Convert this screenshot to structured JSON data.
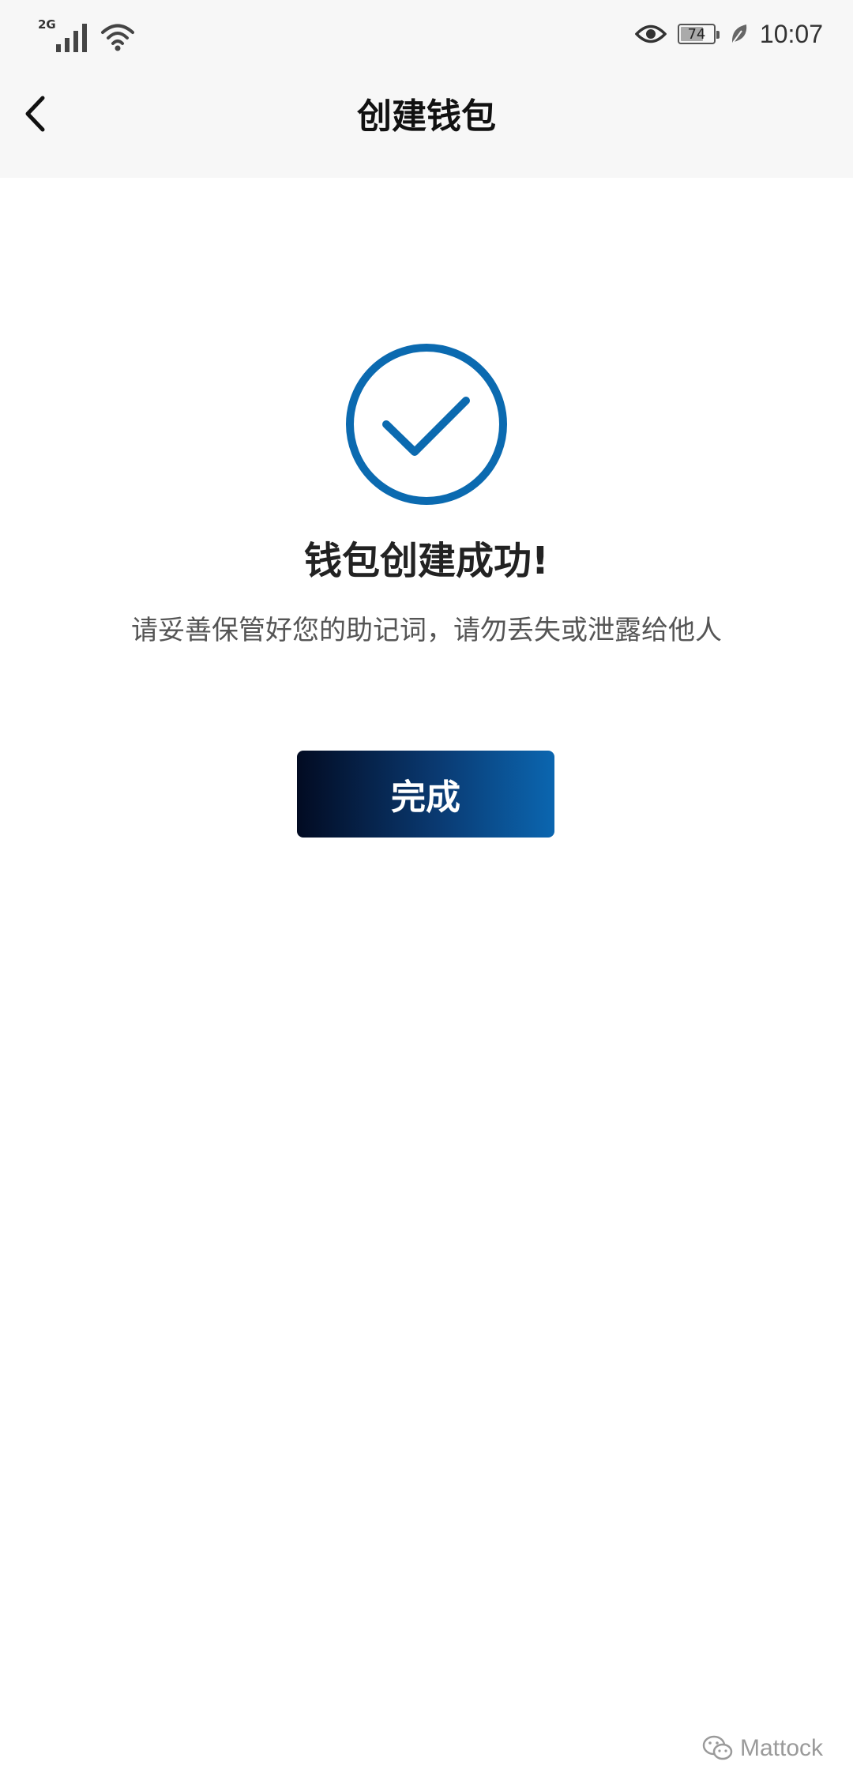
{
  "status_bar": {
    "network_type": "2G",
    "battery_level": "74",
    "battery_fraction": 0.74,
    "time": "10:07",
    "icons": [
      "signal-icon",
      "wifi-icon",
      "eye-icon",
      "battery-icon",
      "leaf-icon"
    ]
  },
  "header": {
    "title": "创建钱包",
    "back_icon": "chevron-left-icon"
  },
  "main": {
    "icon": "check-circle-icon",
    "headline": "钱包创建成功!",
    "message": "请妥善保管好您的助记词，请勿丢失或泄露给他人",
    "done_label": "完成"
  },
  "watermark": {
    "icon": "wechat-icon",
    "text": "Mattock"
  },
  "colors": {
    "accent": "#0b6ab0",
    "button_gradient_start": "#020b22",
    "button_gradient_end": "#0b66b0"
  }
}
